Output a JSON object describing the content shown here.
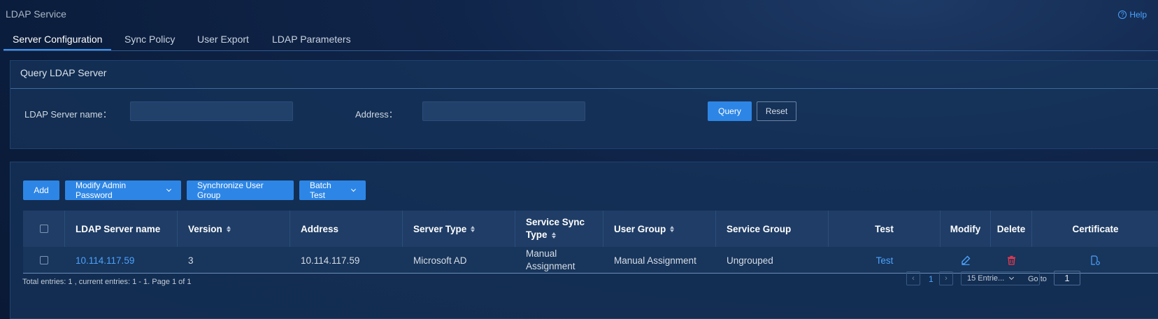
{
  "app": {
    "title": "LDAP Service",
    "help_label": "Help",
    "help_icon_glyph": "?"
  },
  "tabs": [
    {
      "label": "Server Configuration",
      "active": true
    },
    {
      "label": "Sync Policy",
      "active": false
    },
    {
      "label": "User Export",
      "active": false
    },
    {
      "label": "LDAP Parameters",
      "active": false
    }
  ],
  "query_panel": {
    "title": "Query LDAP Server",
    "server_name_label": "LDAP Server name：",
    "server_name_value": "",
    "address_label": "Address：",
    "address_value": "",
    "query_button": "Query",
    "reset_button": "Reset"
  },
  "toolbar": {
    "add": "Add",
    "modify_admin_password": "Modify Admin Password",
    "synchronize_user_group": "Synchronize User Group",
    "batch_test": "Batch Test"
  },
  "table": {
    "columns": {
      "server_name": "LDAP Server name",
      "version": "Version",
      "address": "Address",
      "server_type": "Server Type",
      "service_sync_type_1": "Service Sync",
      "service_sync_type_2": "Type",
      "user_group": "User Group",
      "service_group": "Service Group",
      "test": "Test",
      "modify": "Modify",
      "delete": "Delete",
      "certificate": "Certificate"
    },
    "rows": [
      {
        "server_name": "10.114.117.59",
        "version": "3",
        "address": "10.114.117.59",
        "server_type": "Microsoft AD",
        "service_sync_type_1": "Manual",
        "service_sync_type_2": "Assignment",
        "user_group": "Manual Assignment",
        "service_group": "Ungrouped",
        "test": "Test"
      }
    ]
  },
  "pagination": {
    "summary": "Total entries: 1 , current entries: 1 - 1. Page 1 of 1",
    "prev_glyph": "‹",
    "next_glyph": "›",
    "current_page": "1",
    "page_size": "15 Entrie...",
    "goto_label": "Go to",
    "goto_value": "1"
  },
  "colors": {
    "accent": "#2d86e6",
    "link": "#4aa3ff",
    "delete": "#e8394f",
    "background": "#0b1d3c"
  }
}
